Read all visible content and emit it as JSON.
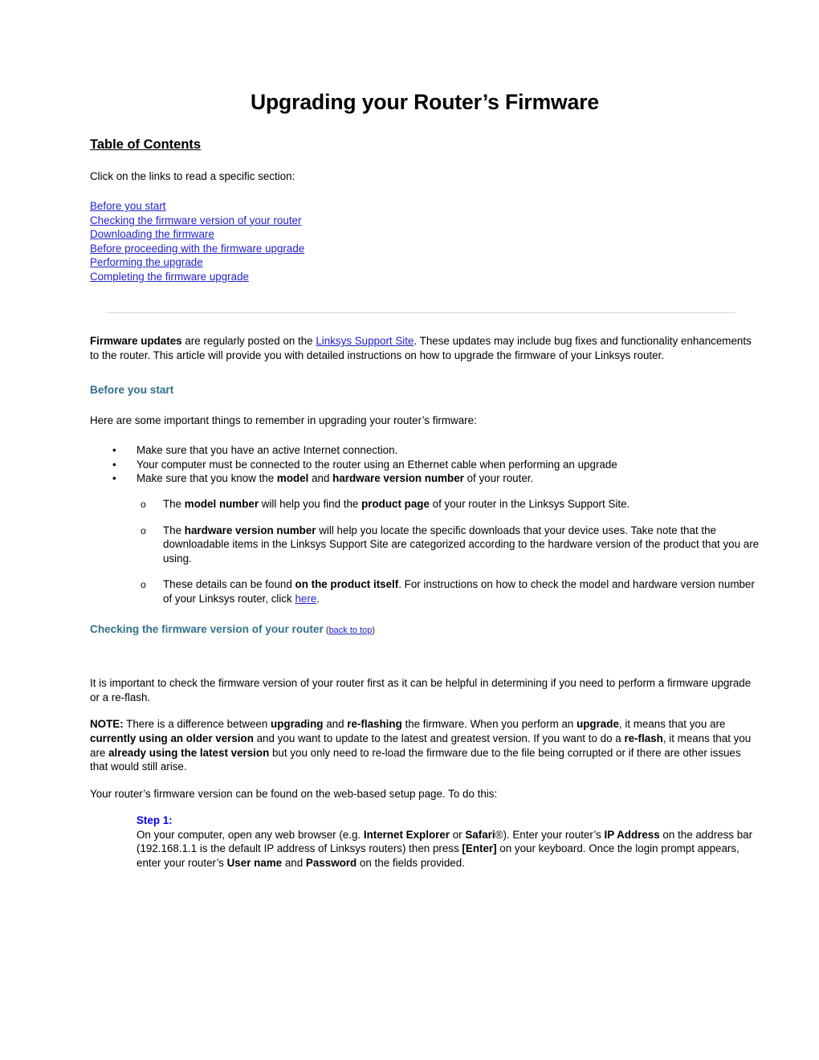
{
  "document": {
    "title": "Upgrading your Router’s Firmware",
    "toc": {
      "heading": "Table of Contents",
      "intro": "Click on the links to read a specific section:",
      "links": [
        "Before you start",
        "Checking the firmware version of your router",
        "Downloading the firmware",
        "Before proceeding with the firmware upgrade",
        "Performing the upgrade",
        "Completing the firmware upgrade"
      ]
    },
    "intro_paragraph": {
      "bold_lead": "Firmware updates",
      "text_before_link": " are regularly posted on the ",
      "link_text": "Linksys Support Site",
      "text_after_link": ".  These updates may include bug fixes and functionality enhancements to the router.  This article will provide you with detailed instructions on how to upgrade the firmware of your Linksys router."
    },
    "section_before_you_start": {
      "heading": "Before you start",
      "intro": "Here are some important things to remember in upgrading your router’s firmware:",
      "bullet_marker": "•",
      "bullets": [
        {
          "parts": [
            {
              "text": "Make sure that you have an active Internet connection.",
              "bold": false
            }
          ]
        },
        {
          "parts": [
            {
              "text": "Your computer must be connected to the router using an Ethernet cable when performing an upgrade",
              "bold": false
            }
          ]
        },
        {
          "parts": [
            {
              "text": "Make sure that you know the ",
              "bold": false
            },
            {
              "text": "model",
              "bold": true
            },
            {
              "text": " and ",
              "bold": false
            },
            {
              "text": "hardware version number",
              "bold": true
            },
            {
              "text": " of your router.",
              "bold": false
            }
          ]
        }
      ],
      "sub_marker": "o",
      "sub_bullets": [
        {
          "parts": [
            {
              "text": "The ",
              "bold": false
            },
            {
              "text": "model number",
              "bold": true
            },
            {
              "text": " will help you find the ",
              "bold": false
            },
            {
              "text": "product page",
              "bold": true
            },
            {
              "text": " of your router in the Linksys Support Site.",
              "bold": false
            }
          ]
        },
        {
          "parts": [
            {
              "text": "The ",
              "bold": false
            },
            {
              "text": "hardware version number",
              "bold": true
            },
            {
              "text": " will help you locate the specific downloads that your device uses.  Take note that the downloadable items in the Linksys Support Site are categorized according to the hardware version of the product that you are using.",
              "bold": false
            }
          ]
        },
        {
          "parts": [
            {
              "text": "These details can be found ",
              "bold": false
            },
            {
              "text": "on the product itself",
              "bold": true
            },
            {
              "text": ".  For instructions on how to check the model and hardware version number of your Linksys router, click ",
              "bold": false
            },
            {
              "text": "here",
              "bold": false,
              "link": true
            },
            {
              "text": ".",
              "bold": false
            }
          ]
        }
      ]
    },
    "section_checking_firmware": {
      "heading": "Checking the firmware version of your router",
      "back_to_top_open": "(",
      "back_to_top_label": "back to top",
      "back_to_top_close": ")",
      "paragraph_1": "It is important to check the firmware version of your router first as it can be helpful in determining if you need to perform a firmware upgrade or a re-flash.",
      "note": {
        "label": "NOTE:",
        "parts": [
          {
            "text": "  There is a difference between ",
            "bold": false
          },
          {
            "text": "upgrading",
            "bold": true
          },
          {
            "text": " and ",
            "bold": false
          },
          {
            "text": "re-flashing",
            "bold": true
          },
          {
            "text": " the firmware.  When you perform an ",
            "bold": false
          },
          {
            "text": "upgrade",
            "bold": true
          },
          {
            "text": ", it means that you are ",
            "bold": false
          },
          {
            "text": "currently using an older version",
            "bold": true
          },
          {
            "text": " and you want to update to the latest and greatest version.  If you want to do a ",
            "bold": false
          },
          {
            "text": "re-flash",
            "bold": true
          },
          {
            "text": ", it means that you are ",
            "bold": false
          },
          {
            "text": "already using the latest version",
            "bold": true
          },
          {
            "text": " but you only need to re-load the firmware due to the file being corrupted or if there are other issues that would still arise.",
            "bold": false
          }
        ]
      },
      "paragraph_2": "Your router’s firmware version can be found on the web-based setup page.  To do this:",
      "step": {
        "label": "Step 1:",
        "parts": [
          {
            "text": "On your computer, open any web browser (e.g. ",
            "bold": false
          },
          {
            "text": "Internet Explorer",
            "bold": true
          },
          {
            "text": " or ",
            "bold": false
          },
          {
            "text": "Safari",
            "bold": true
          },
          {
            "text": "®).  Enter your router’s ",
            "bold": false
          },
          {
            "text": "IP Address",
            "bold": true
          },
          {
            "text": " on the address bar (192.168.1.1 is the default IP address of Linksys routers) then press ",
            "bold": false
          },
          {
            "text": "[Enter]",
            "bold": true
          },
          {
            "text": " on your keyboard.   Once the login prompt appears, enter your router’s ",
            "bold": false
          },
          {
            "text": "User name",
            "bold": true
          },
          {
            "text": " and ",
            "bold": false
          },
          {
            "text": "Password",
            "bold": true
          },
          {
            "text": " on the fields provided.",
            "bold": false
          }
        ]
      }
    },
    "colors": {
      "link": "#2222CC",
      "section_heading": "#33708C",
      "step_label": "#0000EE",
      "divider": "#d4d4d4",
      "text": "#000000"
    }
  }
}
